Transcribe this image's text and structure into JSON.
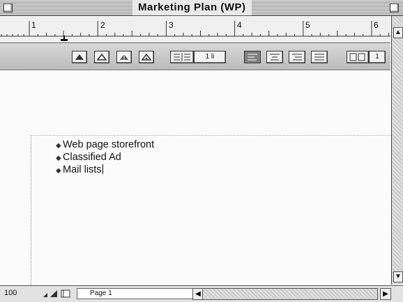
{
  "window": {
    "title": "Marketing Plan (WP)"
  },
  "ruler": {
    "numbers": [
      "1",
      "2",
      "3",
      "4",
      "5",
      "6"
    ]
  },
  "toolbar": {
    "line_spacing": "1 li",
    "columns": "1"
  },
  "document": {
    "lines": [
      {
        "bullet": "◆",
        "text": "Web page storefront"
      },
      {
        "bullet": "◆",
        "text": "Classified Ad"
      },
      {
        "bullet": "◆",
        "text": "Mail lists"
      }
    ]
  },
  "status": {
    "zoom": "100",
    "page": "Page 1"
  },
  "icons": {
    "close": "close-box-icon",
    "zoom": "zoom-box-icon",
    "tab_stop": "tab-stop-marker-icon",
    "scroll_up": "scroll-up-arrow-icon",
    "scroll_down": "scroll-down-arrow-icon",
    "scroll_left": "scroll-left-arrow-icon",
    "scroll_right": "scroll-right-arrow-icon"
  }
}
